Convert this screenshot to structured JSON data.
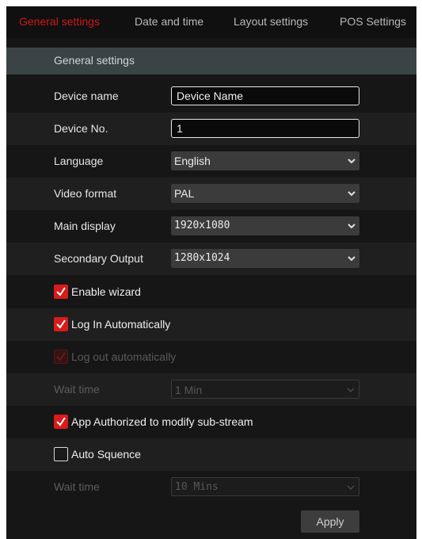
{
  "tabs": [
    {
      "label": "General settings",
      "active": true
    },
    {
      "label": "Date and time",
      "active": false
    },
    {
      "label": "Layout settings",
      "active": false
    },
    {
      "label": "POS Settings",
      "active": false
    }
  ],
  "section": {
    "title": "General settings"
  },
  "fields": {
    "device_name": {
      "label": "Device name",
      "value": "Device Name"
    },
    "device_no": {
      "label": "Device No.",
      "value": "1"
    },
    "language": {
      "label": "Language",
      "value": "English"
    },
    "video_format": {
      "label": "Video format",
      "value": "PAL"
    },
    "main_display": {
      "label": "Main display",
      "value": "1920x1080"
    },
    "secondary_output": {
      "label": "Secondary Output",
      "value": "1280x1024"
    }
  },
  "checks": {
    "enable_wizard": {
      "label": "Enable wizard",
      "checked": true
    },
    "log_in_auto": {
      "label": "Log In Automatically",
      "checked": true
    },
    "log_out_auto": {
      "label": "Log out automatically",
      "checked": true,
      "disabled": true
    },
    "app_authorized": {
      "label": "App Authorized to modify sub-stream",
      "checked": true
    },
    "auto_sequence": {
      "label": "Auto Squence",
      "checked": false
    }
  },
  "wait_time_1": {
    "label": "Wait time",
    "value": "1 Min",
    "disabled": true
  },
  "wait_time_2": {
    "label": "Wait time",
    "value": "10 Mins",
    "disabled": true
  },
  "buttons": {
    "apply": "Apply"
  },
  "colors": {
    "accent": "#d81b1b",
    "background": "#161616",
    "section_header": "#3a4446"
  }
}
